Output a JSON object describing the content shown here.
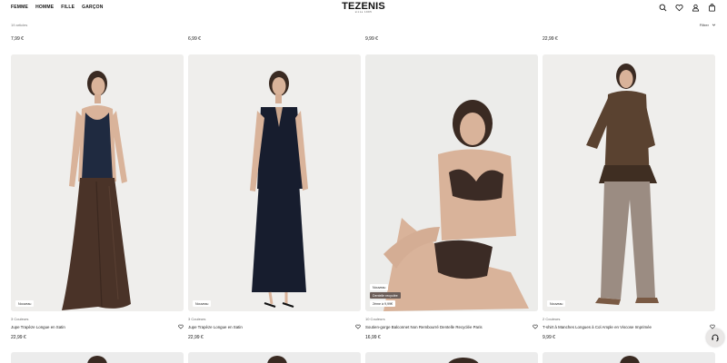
{
  "header": {
    "nav": [
      "FEMME",
      "HOMME",
      "FILLE",
      "GARÇON"
    ],
    "brand": "TEZENIS",
    "brand_sub": "since 1995"
  },
  "toolbar": {
    "results": "19 articles",
    "filter_label": "Filtrer"
  },
  "prev_row_prices": [
    "7,99 €",
    "6,99 €",
    "9,99 €",
    "22,99 €"
  ],
  "products": [
    {
      "badges": [
        "Nouveau"
      ],
      "colors": "3 Couleurs",
      "name": "Jupe Trapèze Longue en Satin",
      "price": "22,99 €"
    },
    {
      "badges": [
        "Nouveau"
      ],
      "colors": "3 Couleurs",
      "name": "Jupe Trapèze Longue en Satin",
      "price": "22,99 €"
    },
    {
      "badges": [
        "Nouveau",
        "Dentelle recyclée",
        "2ème à 9,99€"
      ],
      "colors": "10 Couleurs",
      "name": "Soutien-gorge Balconnet Non Rembourré Dentelle Recyclée Paris",
      "price": "16,99 €"
    },
    {
      "badges": [
        "Nouveau"
      ],
      "colors": "2 Couleurs",
      "name": "T-shirt à Manches Longues à Col Ample en Viscose Imprimée",
      "price": "9,99 €"
    }
  ],
  "colors": {
    "img_bg": "#efefef",
    "skirt_brown": "#4a3328",
    "navy": "#1d2536",
    "skin": "#d9b39a",
    "hair": "#3a2a22"
  }
}
